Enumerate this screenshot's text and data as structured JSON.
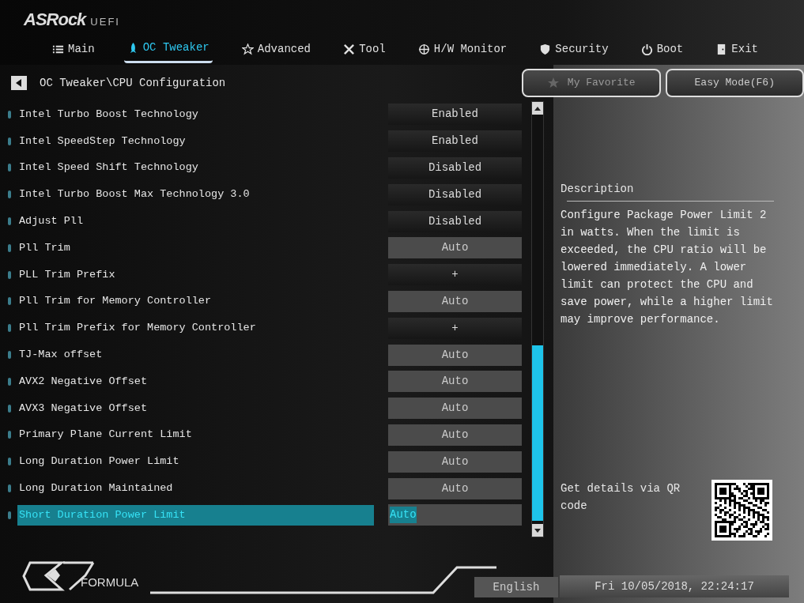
{
  "logo": {
    "brand": "ASRock",
    "suffix": "UEFI"
  },
  "tabs": [
    {
      "label": "Main",
      "selected": false
    },
    {
      "label": "OC Tweaker",
      "selected": true
    },
    {
      "label": "Advanced",
      "selected": false
    },
    {
      "label": "Tool",
      "selected": false
    },
    {
      "label": "H/W Monitor",
      "selected": false
    },
    {
      "label": "Security",
      "selected": false
    },
    {
      "label": "Boot",
      "selected": false
    },
    {
      "label": "Exit",
      "selected": false
    }
  ],
  "breadcrumb": "OC Tweaker\\CPU Configuration",
  "buttons": [
    {
      "label": "My Favorite"
    },
    {
      "label": "Easy Mode(F6)"
    }
  ],
  "settings": [
    {
      "label": "Intel Turbo Boost Technology",
      "value": "Enabled",
      "kind": "option",
      "selected": false
    },
    {
      "label": "Intel SpeedStep Technology",
      "value": "Enabled",
      "kind": "option",
      "selected": false
    },
    {
      "label": "Intel Speed Shift Technology",
      "value": "Disabled",
      "kind": "option",
      "selected": false
    },
    {
      "label": "Intel Turbo Boost Max Technology 3.0",
      "value": "Disabled",
      "kind": "option",
      "selected": false
    },
    {
      "label": "Adjust Pll",
      "value": "Disabled",
      "kind": "option",
      "selected": false
    },
    {
      "label": "Pll Trim",
      "value": "Auto",
      "kind": "input",
      "selected": false
    },
    {
      "label": "PLL Trim Prefix",
      "value": "+",
      "kind": "option",
      "selected": false
    },
    {
      "label": "Pll Trim for Memory Controller",
      "value": "Auto",
      "kind": "input",
      "selected": false
    },
    {
      "label": "Pll Trim Prefix for Memory Controller",
      "value": "+",
      "kind": "option",
      "selected": false
    },
    {
      "label": "TJ-Max offset",
      "value": "Auto",
      "kind": "input",
      "selected": false
    },
    {
      "label": "AVX2 Negative Offset",
      "value": "Auto",
      "kind": "input",
      "selected": false
    },
    {
      "label": "AVX3 Negative Offset",
      "value": "Auto",
      "kind": "input",
      "selected": false
    },
    {
      "label": "Primary Plane Current Limit",
      "value": "Auto",
      "kind": "input",
      "selected": false
    },
    {
      "label": "Long Duration Power Limit",
      "value": "Auto",
      "kind": "input",
      "selected": false
    },
    {
      "label": "Long Duration Maintained",
      "value": "Auto",
      "kind": "input",
      "selected": false
    },
    {
      "label": "Short Duration Power Limit",
      "value": "Auto",
      "kind": "input",
      "selected": true
    }
  ],
  "description": {
    "title": "Description",
    "text": "Configure Package Power Limit 2 in watts. When the limit is exceeded, the CPU ratio will be lowered immediately. A lower limit can protect the CPU and save power, while a higher limit may improve performance.",
    "qr_text": "Get details via QR code"
  },
  "footer": {
    "logo_text": "FORMULA",
    "language": "English",
    "datetime": "Fri 10/05/2018, 22:24:17"
  }
}
